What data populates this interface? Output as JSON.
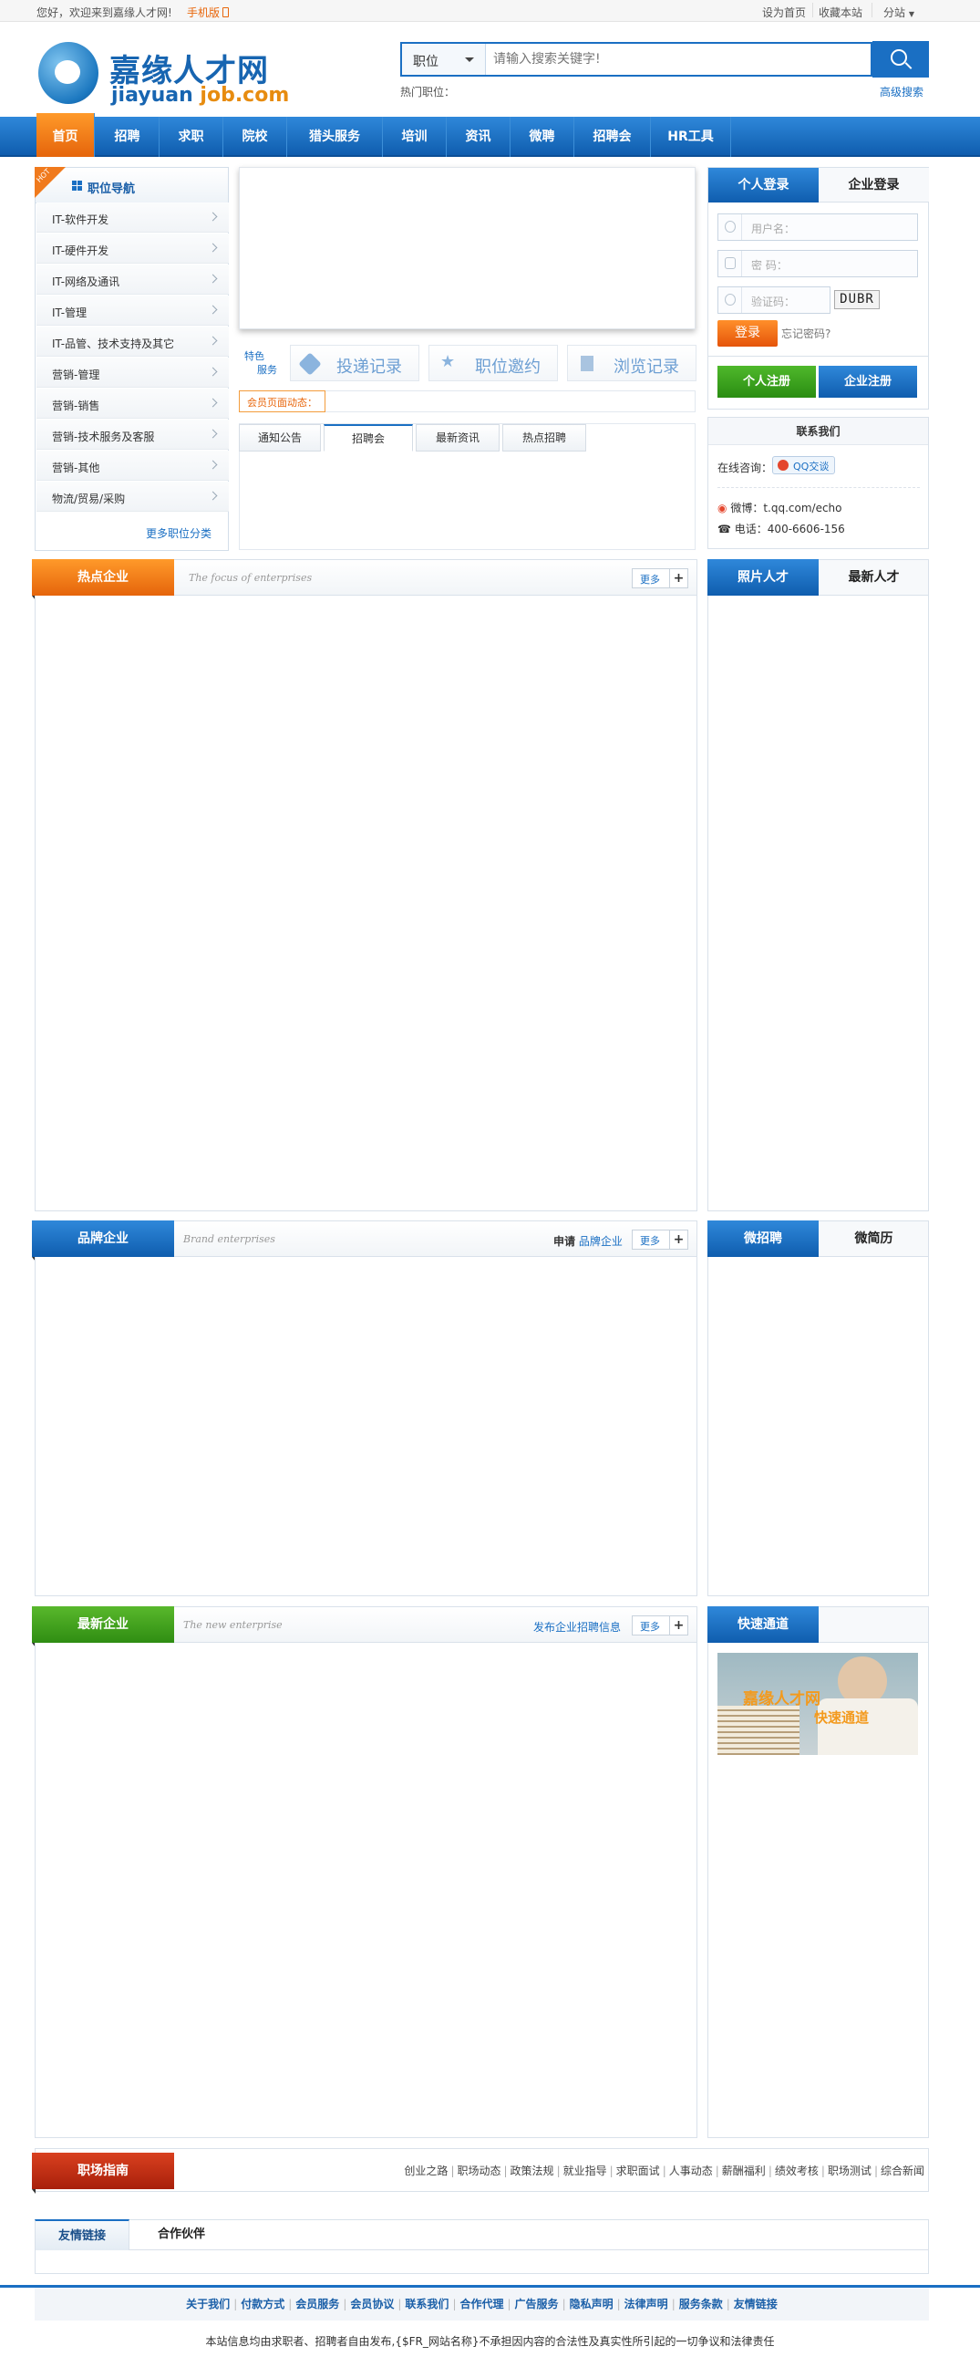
{
  "topbar": {
    "welcome": "您好，欢迎来到嘉缘人才网!",
    "mobile": "手机版",
    "set_home": "设为首页",
    "bookmark": "收藏本站",
    "substation": "分站"
  },
  "header": {
    "logo_cn_a": "嘉缘",
    "logo_cn_b": "人才网",
    "logo_en_a": "jiayuan ",
    "logo_en_b": "job.com",
    "search_category": "职位",
    "search_placeholder": "请输入搜索关键字!",
    "hot_label": "热门职位：",
    "advanced_search": "高级搜索"
  },
  "nav": [
    "首页",
    "招聘",
    "求职",
    "院校",
    "猎头服务",
    "培训",
    "资讯",
    "微聘",
    "招聘会",
    "HR工具"
  ],
  "job_nav": {
    "hot_tag": "HOT",
    "title": "职位导航",
    "items": [
      "IT-软件开发",
      "IT-硬件开发",
      "IT-网络及通讯",
      "IT-管理",
      "IT-品管、技术支持及其它",
      "营销-管理",
      "营销-销售",
      "营销-技术服务及客服",
      "营销-其他",
      "物流/贸易/采购"
    ],
    "more": "更多职位分类"
  },
  "services": {
    "label_1": "特色",
    "label_2": "服务",
    "items": [
      "投递记录",
      "职位邀约",
      "浏览记录"
    ]
  },
  "member_dynamic": "会员页面动态：",
  "news_tabs": [
    "通知公告",
    "招聘会",
    "最新资讯",
    "热点招聘"
  ],
  "login": {
    "tab_personal": "个人登录",
    "tab_company": "企业登录",
    "username_placeholder": "用户名：",
    "password_placeholder": "密   码：",
    "captcha_placeholder": "验证码：",
    "captcha_text": "DUBR",
    "login_button": "登录",
    "forgot": "忘记密码?",
    "register_personal": "个人注册",
    "register_company": "企业注册"
  },
  "contact": {
    "title": "联系我们",
    "online_label": "在线咨询：",
    "qq_label": "QQ交谈",
    "weibo_label": "微博：",
    "weibo_value": "t.qq.com/echo",
    "phone_label": "电话：",
    "phone_value": "400-6606-156"
  },
  "sections": {
    "hot_title": "热点企业",
    "hot_en": "The focus of enterprises",
    "brand_title": "品牌企业",
    "brand_en": "Brand enterprises",
    "brand_apply": "申请",
    "brand_apply_link": "品牌企业",
    "new_title": "最新企业",
    "new_en": "The new enterprise",
    "new_publish": "发布企业招聘信息",
    "more": "更多",
    "plus": "+"
  },
  "right_tabs": {
    "photo_talent": "照片人才",
    "latest_talent": "最新人才",
    "micro_recruit": "微招聘",
    "micro_resume": "微简历",
    "fast_channel": "快速通道",
    "ad_text_1": "嘉缘人才网",
    "ad_text_2": "快速通道"
  },
  "guide": {
    "title": "职场指南",
    "links": [
      "创业之路",
      "职场动态",
      "政策法规",
      "就业指导",
      "求职面试",
      "人事动态",
      "薪酬福利",
      "绩效考核",
      "职场测试",
      "综合新闻"
    ]
  },
  "friend": {
    "tab_links": "友情链接",
    "tab_partners": "合作伙伴"
  },
  "footer": {
    "links": [
      "关于我们",
      "付款方式",
      "会员服务",
      "会员协议",
      "联系我们",
      "合作代理",
      "广告服务",
      "隐私声明",
      "法律声明",
      "服务条款",
      "友情链接"
    ],
    "note": "本站信息均由求职者、招聘者自由发布,{$FR_网站名称}不承担因内容的合法性及真实性所引起的一切争议和法律责任"
  },
  "colors": {
    "primary_blue": "#1a6fc3",
    "orange": "#e5640b",
    "green": "#3a9d1e",
    "red": "#b9280f"
  }
}
